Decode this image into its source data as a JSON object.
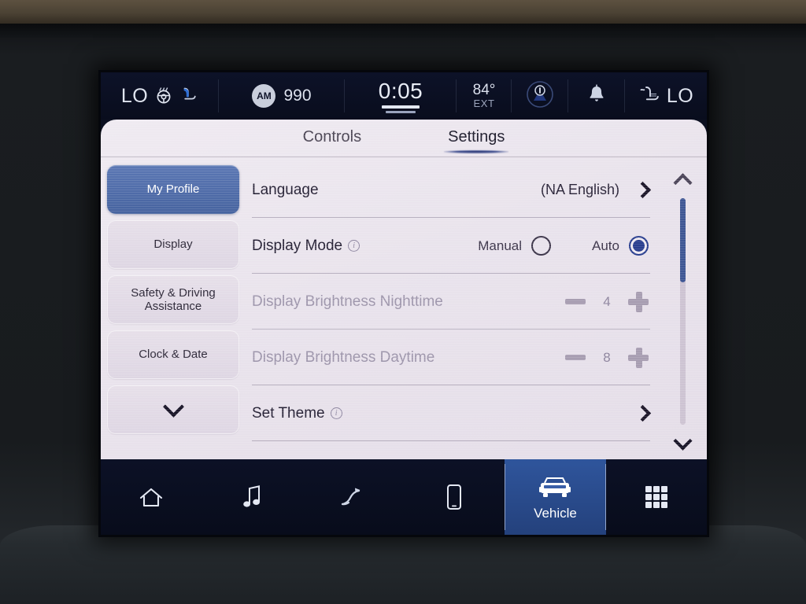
{
  "status_bar": {
    "climate_temp": "LO",
    "steering_wheel_heat_icon": "heated-steering-wheel-icon",
    "driver_seat_icon": "ventilated-seat-icon",
    "radio_band": "AM",
    "radio_frequency": "990",
    "clock": "0:05",
    "exterior_temp": "84°",
    "exterior_temp_label": "EXT",
    "driver_assist_icon": "driver-assist-icon",
    "notification_icon": "bell-icon",
    "passenger_seat_icon": "seat-climate-icon",
    "passenger_temp": "LO"
  },
  "tabs": [
    {
      "label": "Controls",
      "active": false
    },
    {
      "label": "Settings",
      "active": true
    }
  ],
  "sidebar": {
    "items": [
      {
        "label": "My Profile",
        "active": true
      },
      {
        "label": "Display",
        "active": false
      },
      {
        "label": "Safety & Driving Assistance",
        "active": false
      },
      {
        "label": "Clock & Date",
        "active": false
      }
    ],
    "more_button_icon": "chevron-down-icon"
  },
  "settings_rows": [
    {
      "label": "Language",
      "type": "navigation",
      "value": "(NA English)",
      "disabled": false,
      "has_info": false
    },
    {
      "label": "Display Mode",
      "type": "radio",
      "disabled": false,
      "has_info": true,
      "options": [
        {
          "label": "Manual",
          "selected": false
        },
        {
          "label": "Auto",
          "selected": true
        }
      ]
    },
    {
      "label": "Display Brightness Nighttime",
      "type": "stepper",
      "value": "4",
      "disabled": true,
      "has_info": false
    },
    {
      "label": "Display Brightness Daytime",
      "type": "stepper",
      "value": "8",
      "disabled": true,
      "has_info": false
    },
    {
      "label": "Set Theme",
      "type": "navigation",
      "value": "",
      "disabled": false,
      "has_info": true
    }
  ],
  "scroll": {
    "up_icon": "chevron-up-icon",
    "down_icon": "chevron-down-icon",
    "thumb_position_percent": 0
  },
  "nav_bar": [
    {
      "label": "",
      "icon": "home-icon",
      "active": false
    },
    {
      "label": "",
      "icon": "music-note-icon",
      "active": false
    },
    {
      "label": "",
      "icon": "navigation-arrow-icon",
      "active": false
    },
    {
      "label": "",
      "icon": "phone-icon",
      "active": false
    },
    {
      "label": "Vehicle",
      "icon": "vehicle-icon",
      "active": true
    },
    {
      "label": "",
      "icon": "apps-grid-icon",
      "active": false
    }
  ],
  "colors": {
    "accent_blue": "#3e5694",
    "active_nav_blue": "#2f559c",
    "panel_background": "#e9e3ec",
    "status_bar": "#0b0f20",
    "disabled_text": "#9d95ab"
  }
}
